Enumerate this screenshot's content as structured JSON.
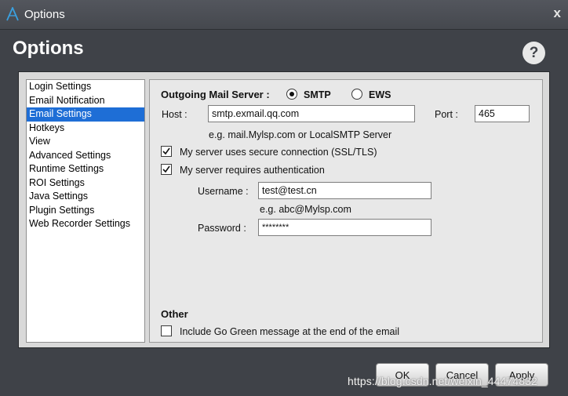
{
  "window": {
    "title": "Options",
    "close": "x"
  },
  "header": {
    "title": "Options",
    "help": "?"
  },
  "nav": {
    "items": [
      "Login Settings",
      "Email Notification",
      "Email Settings",
      "Hotkeys",
      "View",
      "Advanced Settings",
      "Runtime Settings",
      "ROI Settings",
      "Java Settings",
      "Plugin Settings",
      "Web Recorder Settings"
    ],
    "selected_index": 2
  },
  "email": {
    "server_label": "Outgoing Mail Server :",
    "smtp_label": "SMTP",
    "ews_label": "EWS",
    "smtp_selected": true,
    "host_label": "Host :",
    "host_value": "smtp.exmail.qq.com",
    "host_hint": "e.g. mail.Mylsp.com or LocalSMTP Server",
    "port_label": "Port :",
    "port_value": "465",
    "ssl_label": "My server uses secure connection (SSL/TLS)",
    "ssl_checked": true,
    "auth_label": "My server requires authentication",
    "auth_checked": true,
    "username_label": "Username :",
    "username_value": "test@test.cn",
    "username_hint": "e.g. abc@Mylsp.com",
    "password_label": "Password :",
    "password_value": "********"
  },
  "other": {
    "section_label": "Other",
    "go_green_label": "Include Go Green message at the end of the email",
    "go_green_checked": false
  },
  "buttons": {
    "ok": "OK",
    "cancel": "Cancel",
    "apply": "Apply"
  },
  "watermark": "https://blog.csdn.net/weixin_44474832",
  "colors": {
    "selected": "#1e6ed6",
    "window_bg": "#3f4248"
  }
}
